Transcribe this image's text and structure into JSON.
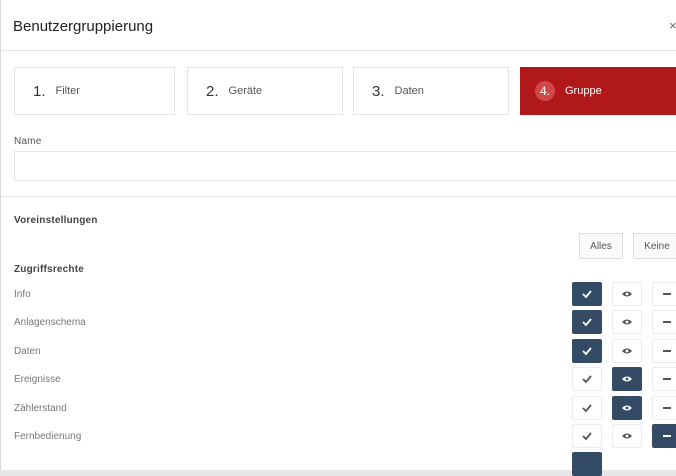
{
  "dialog": {
    "title": "Benutzergruppierung",
    "close_glyph": "×"
  },
  "steps": [
    {
      "number": "1.",
      "label": "Filter",
      "active": false
    },
    {
      "number": "2.",
      "label": "Geräte",
      "active": false
    },
    {
      "number": "3.",
      "label": "Daten",
      "active": false
    },
    {
      "number": "4.",
      "label": "Gruppe",
      "active": true
    }
  ],
  "name": {
    "label": "Name",
    "value": "",
    "placeholder": ""
  },
  "presets": {
    "label": "Voreinstellungen",
    "all_label": "Alles",
    "none_label": "Keine"
  },
  "permissions": {
    "heading": "Zugriffsrechte",
    "rows": [
      {
        "label": "Info",
        "selected": "full"
      },
      {
        "label": "Anlagenschema",
        "selected": "full"
      },
      {
        "label": "Daten",
        "selected": "full"
      },
      {
        "label": "Ereignisse",
        "selected": "view"
      },
      {
        "label": "Zählerstand",
        "selected": "view"
      },
      {
        "label": "Fernbedienung",
        "selected": "none"
      }
    ]
  },
  "colors": {
    "accent": "#b0181a",
    "selected_button": "#344b66"
  },
  "icons": {
    "full": "check-icon",
    "view": "eye-icon",
    "none": "minus-icon"
  }
}
